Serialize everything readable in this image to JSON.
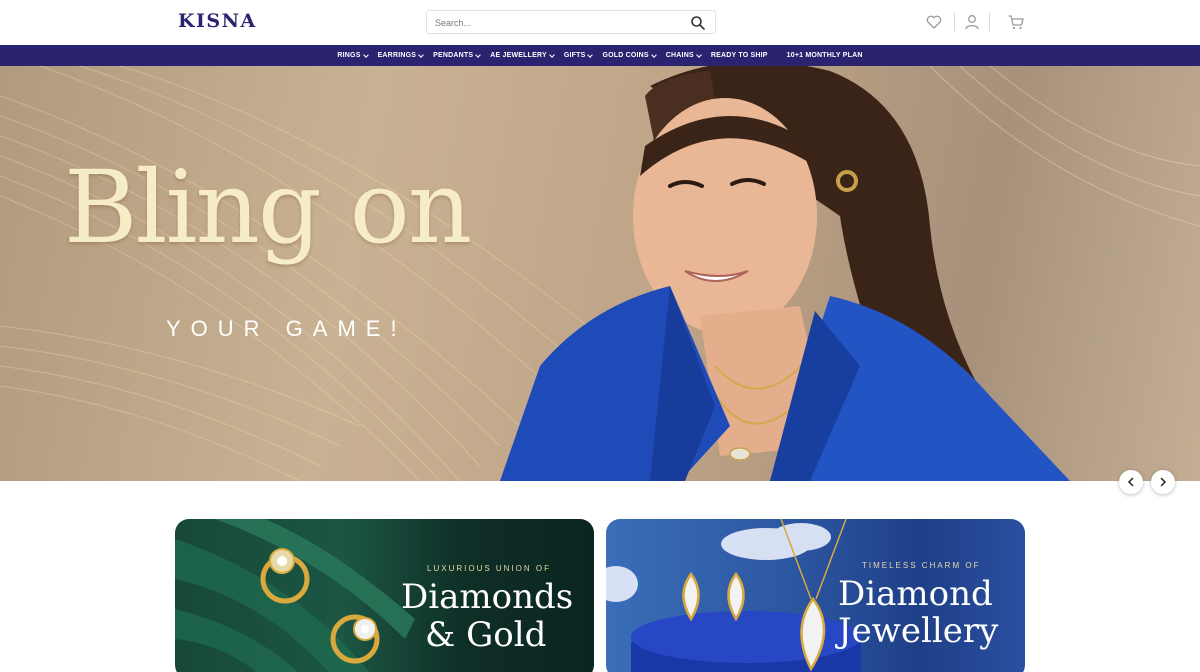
{
  "header": {
    "logo": "KISNA",
    "search": {
      "placeholder": "Search..."
    },
    "icons": [
      "search-icon",
      "heart-icon",
      "user-icon",
      "cart-icon"
    ]
  },
  "nav": {
    "items": [
      {
        "label": "RINGS",
        "has_dropdown": true
      },
      {
        "label": "EARRINGS",
        "has_dropdown": true
      },
      {
        "label": "PENDANTS",
        "has_dropdown": true
      },
      {
        "label": "AE JEWELLERY",
        "has_dropdown": true
      },
      {
        "label": "GIFTS",
        "has_dropdown": true
      },
      {
        "label": "GOLD COINS",
        "has_dropdown": true
      },
      {
        "label": "CHAINS",
        "has_dropdown": true
      },
      {
        "label": "READY TO SHIP",
        "has_dropdown": false
      },
      {
        "label": "10+1 MONTHLY PLAN",
        "has_dropdown": false
      }
    ]
  },
  "hero": {
    "title": "Bling on",
    "subtitle": "YOUR GAME!",
    "controls": [
      "chevron-left-icon",
      "chevron-right-icon"
    ]
  },
  "cards": [
    {
      "eyebrow": "LUXURIOUS UNION OF",
      "title_line1": "Diamonds",
      "title_line2": "& Gold"
    },
    {
      "eyebrow": "TIMELESS CHARM OF",
      "title_line1": "Diamond",
      "title_line2": "Jewellery"
    }
  ],
  "colors": {
    "brand": "#2a2370",
    "hero_title": "#f6ecc6",
    "card_green": "#174838",
    "card_blue": "#2c56a0"
  }
}
